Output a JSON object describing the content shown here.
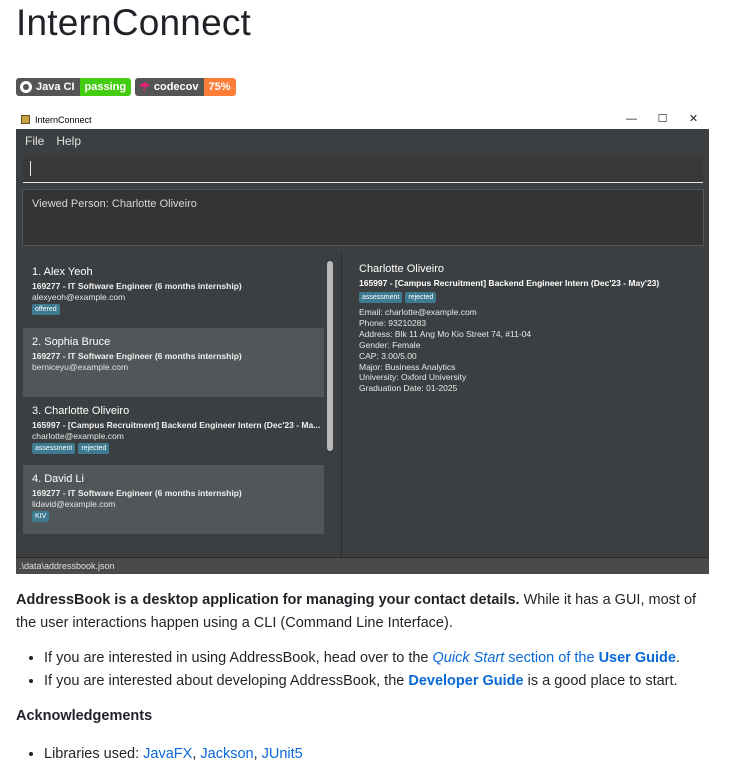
{
  "title": "InternConnect",
  "badges": [
    {
      "left": "Java CI",
      "right": "passing"
    },
    {
      "left": "codecov",
      "right": "75%"
    }
  ],
  "app": {
    "window_title": "InternConnect",
    "window_controls": [
      "—",
      "☐",
      "✕"
    ],
    "menu": [
      "File",
      "Help"
    ],
    "command_value": "",
    "result": "Viewed Person: Charlotte Oliveiro",
    "list": [
      {
        "name": "1.  Alex Yeoh",
        "role": "169277 - IT Software Engineer (6 months internship)",
        "email": "alexyeoh@example.com",
        "tags": [
          "offered"
        ]
      },
      {
        "name": "2.  Sophia Bruce",
        "role": "169277 - IT Software Engineer (6 months internship)",
        "email": "berniceyu@example.com",
        "tags": []
      },
      {
        "name": "3.  Charlotte Oliveiro",
        "role": "165997 - [Campus Recruitment] Backend Engineer Intern (Dec'23 - Ma...",
        "email": "charlotte@example.com",
        "tags": [
          "assessment",
          "rejected"
        ]
      },
      {
        "name": "4.  David Li",
        "role": "169277 - IT Software Engineer (6 months internship)",
        "email": "lidavid@example.com",
        "tags": [
          "KIV"
        ]
      }
    ],
    "detail": {
      "name": "Charlotte Oliveiro",
      "role": "165997 - [Campus Recruitment] Backend Engineer Intern (Dec'23 - May'23)",
      "tags": [
        "assessment",
        "rejected"
      ],
      "info": [
        "Email: charlotte@example.com",
        "Phone: 93210283",
        "Address: Blk 11 Ang Mo Kio Street 74, #11-04",
        "Gender: Female",
        "CAP: 3.00/5.00",
        "Major: Business Analytics",
        "University: Oxford University",
        "Graduation Date: 01-2025"
      ]
    },
    "status": ".\\data\\addressbook.json"
  },
  "intro": {
    "bold": "AddressBook is a desktop application for managing your contact details.",
    "rest": " While it has a GUI, most of the user interactions happen using a CLI (Command Line Interface)."
  },
  "bullets": {
    "b1_pre": "If you are interested in using AddressBook, head over to the ",
    "b1_link1": "Quick Start",
    "b1_mid": " section of the ",
    "b1_link2": "User Guide",
    "b1_end": ".",
    "b2_pre": "If you are interested about developing AddressBook, the ",
    "b2_link": "Developer Guide",
    "b2_end": " is a good place to start."
  },
  "ack": {
    "heading": "Acknowledgements",
    "pre": "Libraries used: ",
    "libs": [
      "JavaFX",
      "Jackson",
      "JUnit5"
    ]
  }
}
